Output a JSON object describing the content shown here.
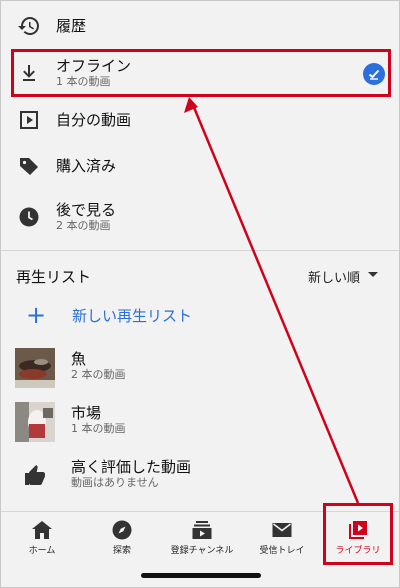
{
  "library": {
    "items": [
      {
        "title": "履歴",
        "subtitle": "",
        "icon": "history-icon"
      },
      {
        "title": "オフライン",
        "subtitle": "1 本の動画",
        "icon": "download-icon",
        "selected": true
      },
      {
        "title": "自分の動画",
        "subtitle": "",
        "icon": "play-box-icon"
      },
      {
        "title": "購入済み",
        "subtitle": "",
        "icon": "tag-icon"
      },
      {
        "title": "後で見る",
        "subtitle": "2 本の動画",
        "icon": "clock-icon"
      }
    ]
  },
  "playlists": {
    "section_title": "再生リスト",
    "sort_label": "新しい順",
    "new_playlist_label": "新しい再生リスト",
    "items": [
      {
        "title": "魚",
        "subtitle": "2 本の動画"
      },
      {
        "title": "市場",
        "subtitle": "1 本の動画"
      },
      {
        "title": "高く評価した動画",
        "subtitle": "動画はありません"
      }
    ]
  },
  "bottom_nav": {
    "items": [
      {
        "label": "ホーム",
        "icon": "home-icon"
      },
      {
        "label": "探索",
        "icon": "explore-icon"
      },
      {
        "label": "登録チャンネル",
        "icon": "subscriptions-icon"
      },
      {
        "label": "受信トレイ",
        "icon": "inbox-icon"
      },
      {
        "label": "ライブラリ",
        "icon": "library-icon",
        "active": true
      }
    ]
  },
  "colors": {
    "accent": "#2a6fdb",
    "annotation": "#d0021b"
  }
}
